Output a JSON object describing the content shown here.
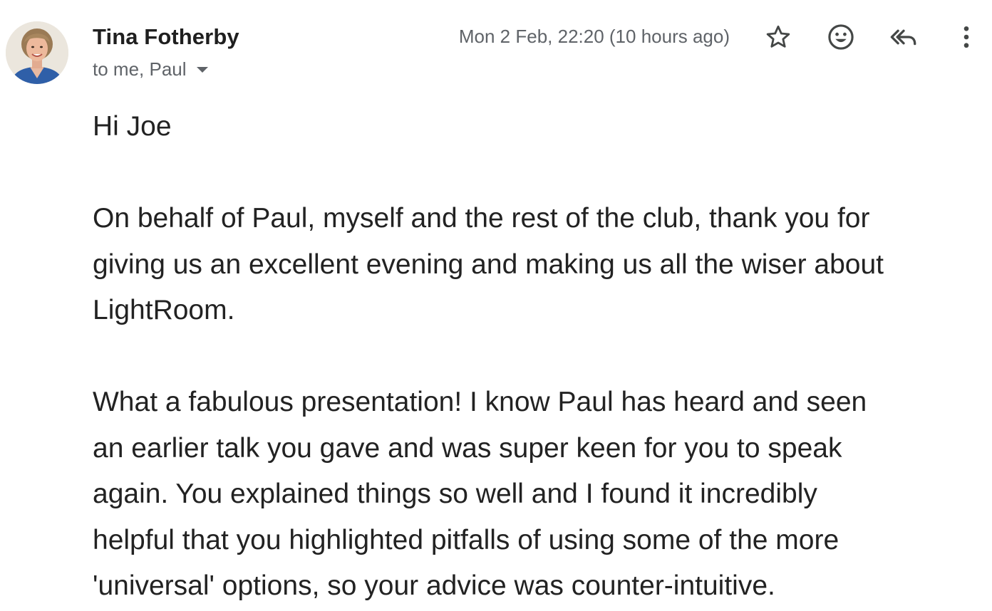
{
  "header": {
    "sender_name": "Tina Fotherby",
    "recipients": "to me, Paul",
    "timestamp": "Mon 2 Feb, 22:20 (10 hours ago)",
    "icons": {
      "avatar": "sender-avatar",
      "star": "star-icon",
      "emoji": "emoji-icon",
      "reply_all": "reply-all-icon",
      "more": "more-vert-icon",
      "caret": "chevron-down-icon"
    },
    "colors": {
      "name_text": "#1f1f1f",
      "secondary_text": "#5f6368",
      "icon": "#444746"
    }
  },
  "body": {
    "greeting": "Hi Joe",
    "paragraph1": [
      "On behalf of Paul, myself and the rest of the club, thank you for",
      "giving us an excellent evening and making us all the wiser about",
      "LightRoom."
    ],
    "paragraph2": [
      "What a fabulous presentation!  I know Paul has heard and seen",
      "an earlier talk you gave and was super keen for you to speak",
      "again.  You explained things so well and I found it incredibly",
      "helpful that you highlighted pitfalls of using some of the more",
      "'universal' options, so your advice was counter-intuitive."
    ],
    "text_color": "#222222"
  }
}
